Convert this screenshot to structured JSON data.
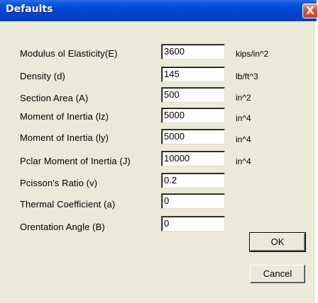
{
  "window": {
    "title": "Defaults",
    "close_glyph": "X"
  },
  "rows": [
    {
      "label": "Modulus ol Elasticity(E)",
      "value": "3600",
      "unit": "kips/in^2"
    },
    {
      "label": "Density (d)",
      "value": "145",
      "unit": "lb/ft^3"
    },
    {
      "label": "Section Area (A)",
      "value": "500",
      "unit": "in^2"
    },
    {
      "label": "Moment of Inertia (lz)",
      "value": "5000",
      "unit": "in^4"
    },
    {
      "label": "Moment of Inertia (ly)",
      "value": "5000",
      "unit": "in^4"
    },
    {
      "label": "Pclar Moment of Inertia (J)",
      "value": "10000",
      "unit": "in^4"
    },
    {
      "label": "Pcisson's Ratio (v)",
      "value": "0.2",
      "unit": ""
    },
    {
      "label": "Thermal Coefficient (a)",
      "value": "0",
      "unit": ""
    },
    {
      "label": "Orentation Angle (B)",
      "value": "0",
      "unit": ""
    }
  ],
  "buttons": {
    "ok": "OK",
    "cancel": "Cancel"
  },
  "colors": {
    "titlebar": "#0546d3",
    "dialog_bg": "#ece9d8",
    "close_button": "#d9593c"
  }
}
